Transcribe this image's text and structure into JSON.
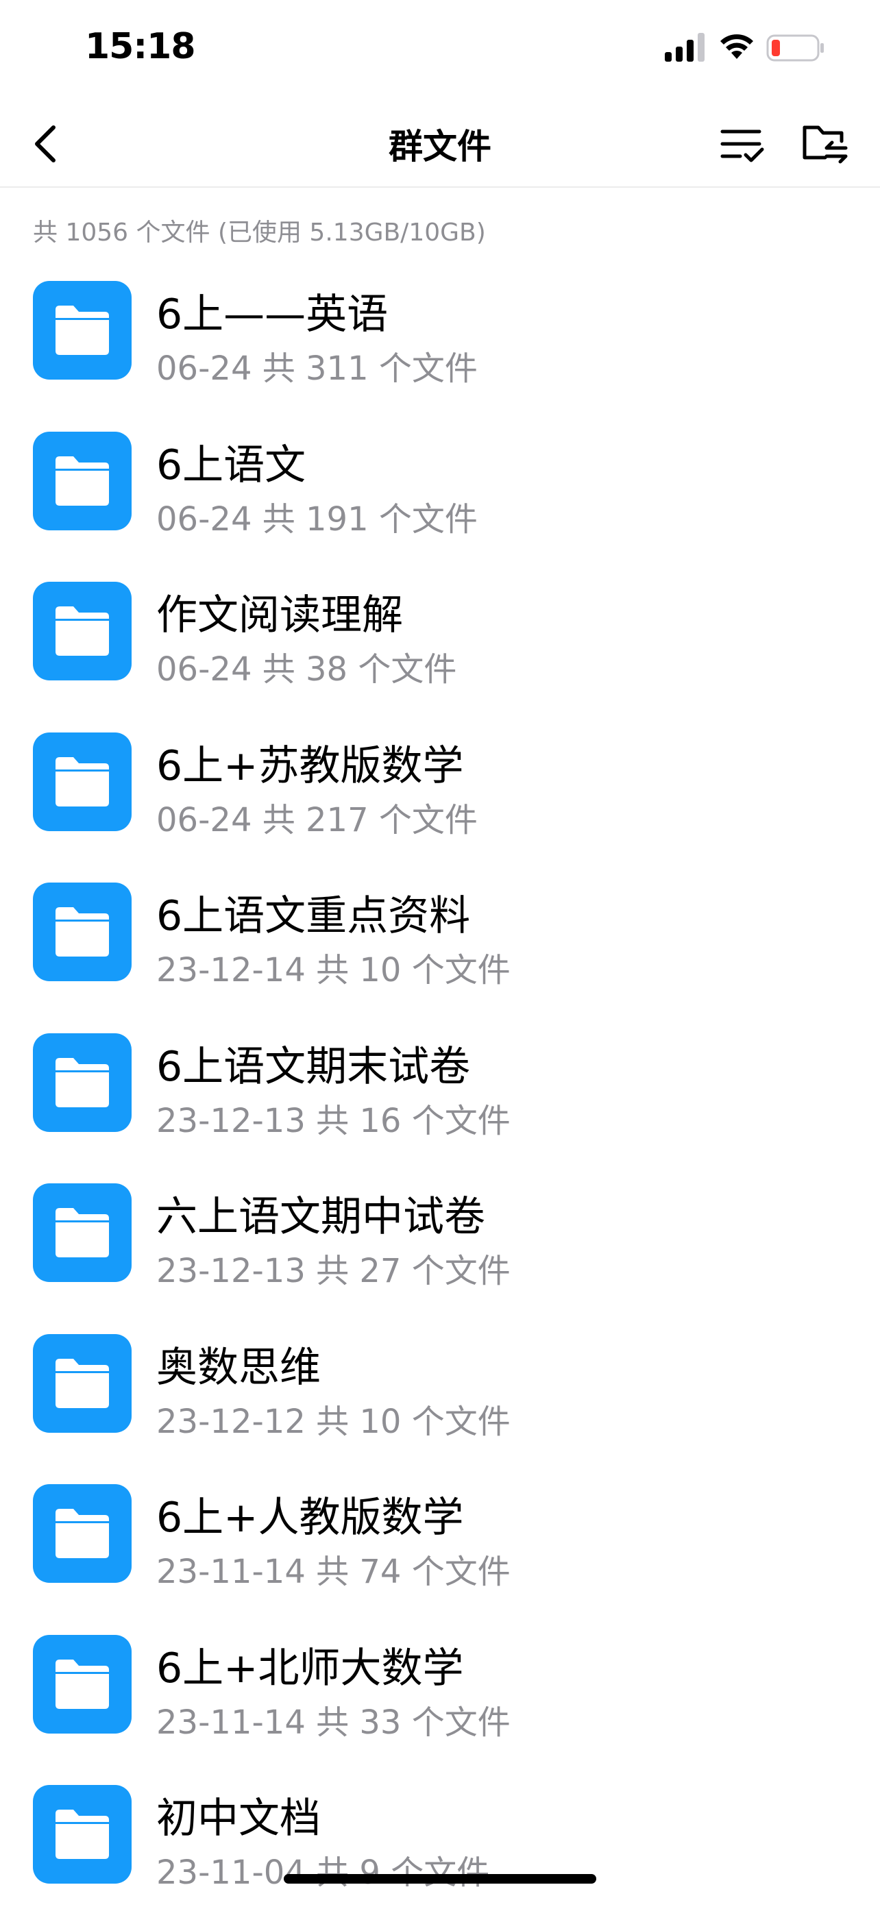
{
  "status_bar": {
    "time": "15:18",
    "battery_color": "#ff3b30"
  },
  "nav": {
    "title": "群文件",
    "back_icon": "chevron-left-icon",
    "sort_icon": "sort-list-icon",
    "transfer_icon": "folder-transfer-icon"
  },
  "summary": "共 1056 个文件 (已使用 5.13GB/10GB)",
  "accent_color": "#169bfa",
  "files": [
    {
      "name": "6上——英语",
      "meta": "06-24 共 311 个文件"
    },
    {
      "name": "6上语文",
      "meta": "06-24 共 191 个文件"
    },
    {
      "name": "作文阅读理解",
      "meta": "06-24 共 38 个文件"
    },
    {
      "name": "6上+苏教版数学",
      "meta": "06-24 共 217 个文件"
    },
    {
      "name": "6上语文重点资料",
      "meta": "23-12-14 共 10 个文件"
    },
    {
      "name": "6上语文期末试卷",
      "meta": "23-12-13 共 16 个文件"
    },
    {
      "name": "六上语文期中试卷",
      "meta": "23-12-13 共 27 个文件"
    },
    {
      "name": "奥数思维",
      "meta": "23-12-12 共 10 个文件"
    },
    {
      "name": "6上+人教版数学",
      "meta": "23-11-14 共 74 个文件"
    },
    {
      "name": "6上+北师大数学",
      "meta": "23-11-14 共 33 个文件"
    },
    {
      "name": "初中文档",
      "meta": "23-11-04 共 9 个文件"
    }
  ]
}
